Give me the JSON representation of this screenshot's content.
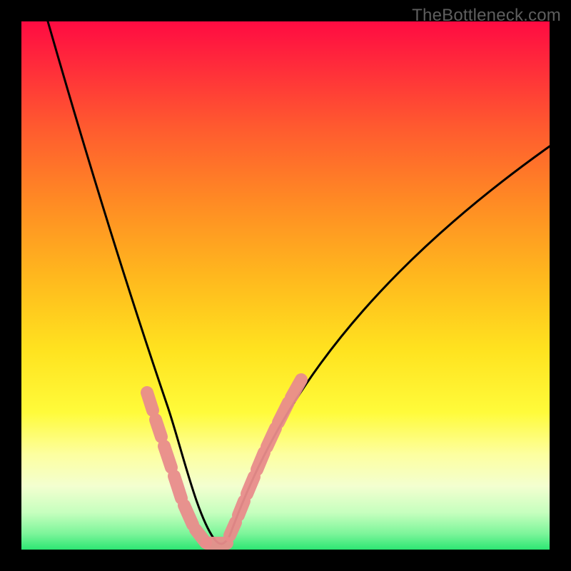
{
  "watermark": "TheBottleneck.com",
  "chart_data": {
    "type": "line",
    "title": "",
    "xlabel": "",
    "ylabel": "",
    "xlim": [
      0,
      100
    ],
    "ylim": [
      0,
      100
    ],
    "series": [
      {
        "name": "bottleneck-curve",
        "x": [
          5,
          10,
          15,
          20,
          25,
          28,
          30,
          33,
          35,
          37,
          38,
          40,
          45,
          50,
          55,
          60,
          65,
          70,
          75,
          80,
          85,
          90,
          95,
          100
        ],
        "values": [
          100,
          84,
          69,
          54,
          37,
          25,
          17,
          6,
          1,
          0,
          0,
          2,
          15,
          27,
          37,
          45,
          51,
          57,
          62,
          66,
          70,
          73,
          75,
          77
        ]
      }
    ],
    "highlight_zones": [
      {
        "name": "left-marker-band",
        "x_range": [
          24,
          34
        ],
        "y_range": [
          4,
          30
        ]
      },
      {
        "name": "right-marker-band",
        "x_range": [
          39,
          52
        ],
        "y_range": [
          2,
          30
        ]
      }
    ],
    "gradient_bands": [
      {
        "color": "#ff0b42",
        "y": 100
      },
      {
        "color": "#ff8a24",
        "y": 66
      },
      {
        "color": "#ffe21f",
        "y": 38
      },
      {
        "color": "#fdffa0",
        "y": 18
      },
      {
        "color": "#2de673",
        "y": 0
      }
    ]
  }
}
